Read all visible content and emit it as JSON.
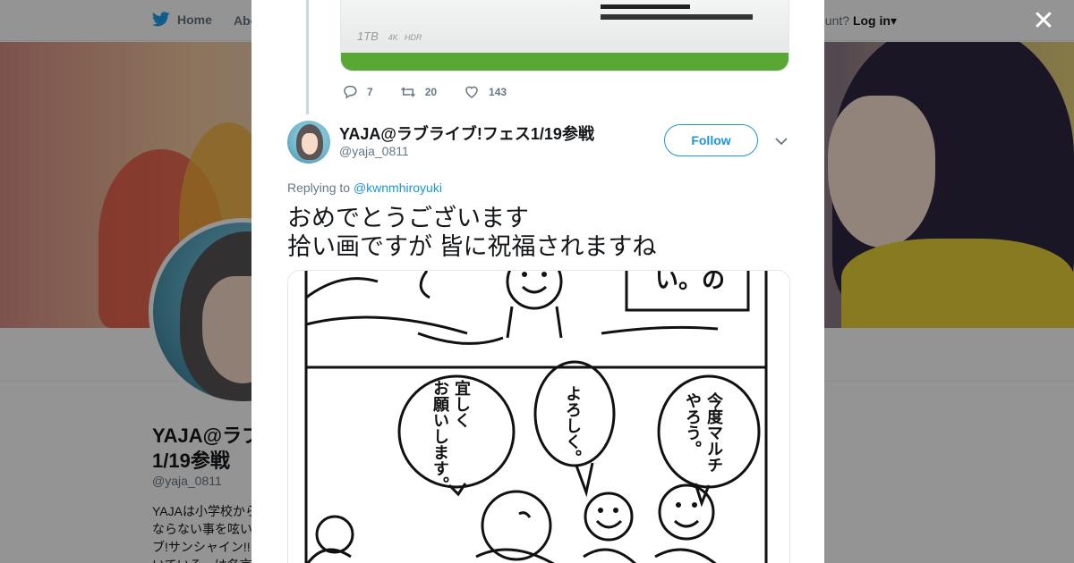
{
  "nav": {
    "home_label": "Home",
    "about_label": "Abo",
    "account_prompt": "ccount?",
    "login_label": "Log in"
  },
  "profile": {
    "name_line1": "YAJA@ラブ",
    "name_line2": "1/19参戦",
    "handle": "@yaja_0811",
    "bio": "YAJAは小学校から\nならない事を呟い\nブ!サンシャイン!!\nいている、は名言"
  },
  "previous_tweet": {
    "image_text": "1TB",
    "image_badge_4k": "4K",
    "image_badge_hdr": "HDR",
    "replies": "7",
    "retweets": "20",
    "likes": "143"
  },
  "tweet": {
    "author_name": "YAJA@ラブライブ!フェス1/19参戦",
    "author_handle": "@yaja_0811",
    "follow_label": "Follow",
    "replying_prefix": "Replying to",
    "replying_to": "@kwnmhiroyuki",
    "text": "おめでとうございます\n拾い画ですが 皆に祝福されますね",
    "manga": {
      "top_panel_text": "い。の",
      "bubble_1": "宜しく\nお願いします。",
      "bubble_2": "よろしく。",
      "bubble_3": "今度マルチ\nやろう。"
    }
  },
  "icons": {
    "close": "close-icon",
    "twitter": "twitter-bird-icon",
    "reply": "reply-icon",
    "retweet": "retweet-icon",
    "like": "heart-icon",
    "caret": "chevron-down-icon"
  }
}
